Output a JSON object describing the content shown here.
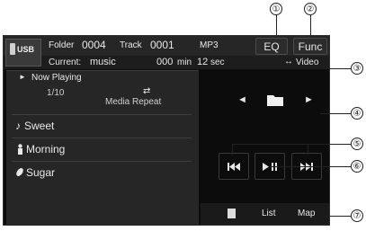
{
  "header": {
    "source_label": "USB",
    "folder_label": "Folder",
    "folder_value": "0004",
    "track_label": "Track",
    "track_value": "0001",
    "format": "MP3",
    "current_label": "Current:",
    "current_value": "music",
    "time_min_value": "000",
    "time_min_unit": "min",
    "time_sec_value": "12",
    "time_sec_unit": "sec",
    "eq_label": "EQ",
    "func_label": "Func",
    "video_label": "Video"
  },
  "now_playing": {
    "label": "Now Playing",
    "track_position": "1/10",
    "repeat_label": "Media Repeat"
  },
  "songs": [
    {
      "title": "Sweet",
      "icon": "music-note-icon"
    },
    {
      "title": "Morning",
      "icon": "artist-icon"
    },
    {
      "title": "Sugar",
      "icon": "album-icon"
    }
  ],
  "bottom_bar": {
    "list_label": "List",
    "map_label": "Map"
  },
  "callouts": [
    "①",
    "②",
    "③",
    "④",
    "⑤",
    "⑥",
    "⑦"
  ]
}
